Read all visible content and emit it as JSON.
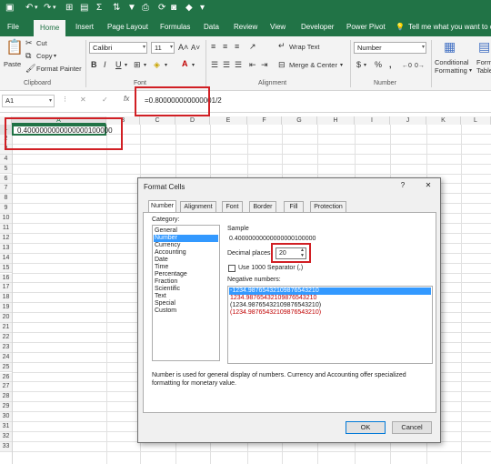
{
  "ribbon_tabs": [
    "File",
    "Home",
    "Insert",
    "Page Layout",
    "Formulas",
    "Data",
    "Review",
    "View",
    "Developer",
    "Power Pivot"
  ],
  "tell_me": "Tell me what you want to do",
  "clipboard": {
    "paste": "Paste",
    "cut": "Cut",
    "copy": "Copy",
    "format_painter": "Format Painter",
    "group": "Clipboard"
  },
  "font": {
    "name": "Calibri",
    "size": "11",
    "group": "Font",
    "bold": "B",
    "italic": "I",
    "underline": "U"
  },
  "alignment": {
    "wrap": "Wrap Text",
    "merge": "Merge & Center",
    "group": "Alignment"
  },
  "number": {
    "format": "Number",
    "group": "Number",
    "currency": "$",
    "percent": "%",
    "comma": ","
  },
  "styles": {
    "conditional": "Conditional",
    "formatting": "Formatting",
    "format_table": "Forma",
    "table": "Table"
  },
  "formula_bar": {
    "name_box": "A1",
    "fx": "fx",
    "formula": "=0.800000000000001/2"
  },
  "columns": [
    "A",
    "B",
    "C",
    "D",
    "E",
    "F",
    "G",
    "H",
    "I",
    "J",
    "K",
    "L"
  ],
  "rows": [
    "1",
    "2",
    "3",
    "4",
    "5",
    "6",
    "7",
    "8",
    "9",
    "10",
    "11",
    "12",
    "13",
    "14",
    "15",
    "16",
    "17",
    "18",
    "19",
    "20",
    "21",
    "22",
    "23",
    "24",
    "25",
    "26",
    "27",
    "28",
    "29",
    "30",
    "31",
    "32",
    "33"
  ],
  "cell_a1": "0.4000000000000000100000",
  "dialog": {
    "title": "Format Cells",
    "help": "?",
    "close": "✕",
    "tabs": [
      "Number",
      "Alignment",
      "Font",
      "Border",
      "Fill",
      "Protection"
    ],
    "category_label": "Category:",
    "categories": [
      "General",
      "Number",
      "Currency",
      "Accounting",
      "Date",
      "Time",
      "Percentage",
      "Fraction",
      "Scientific",
      "Text",
      "Special",
      "Custom"
    ],
    "selected_category": "Number",
    "sample_label": "Sample",
    "sample_value": "0.40000000000000000100000",
    "decimal_label": "Decimal places:",
    "decimal_value": "20",
    "separator_label": "Use 1000 Separator (,)",
    "negative_label": "Negative numbers:",
    "negative_options": [
      "-1234.98765432109876543210",
      "1234.98765432109876543210",
      "(1234.98765432109876543210)",
      "(1234.98765432109876543210)"
    ],
    "description": "Number is used for general display of numbers.  Currency and Accounting offer specialized formatting for monetary value.",
    "ok": "OK",
    "cancel": "Cancel"
  },
  "colors": {
    "excel_green": "#217346",
    "highlight_red": "#d11f24",
    "negative_red": "#c00000",
    "selected_blue": "#3399ff"
  }
}
